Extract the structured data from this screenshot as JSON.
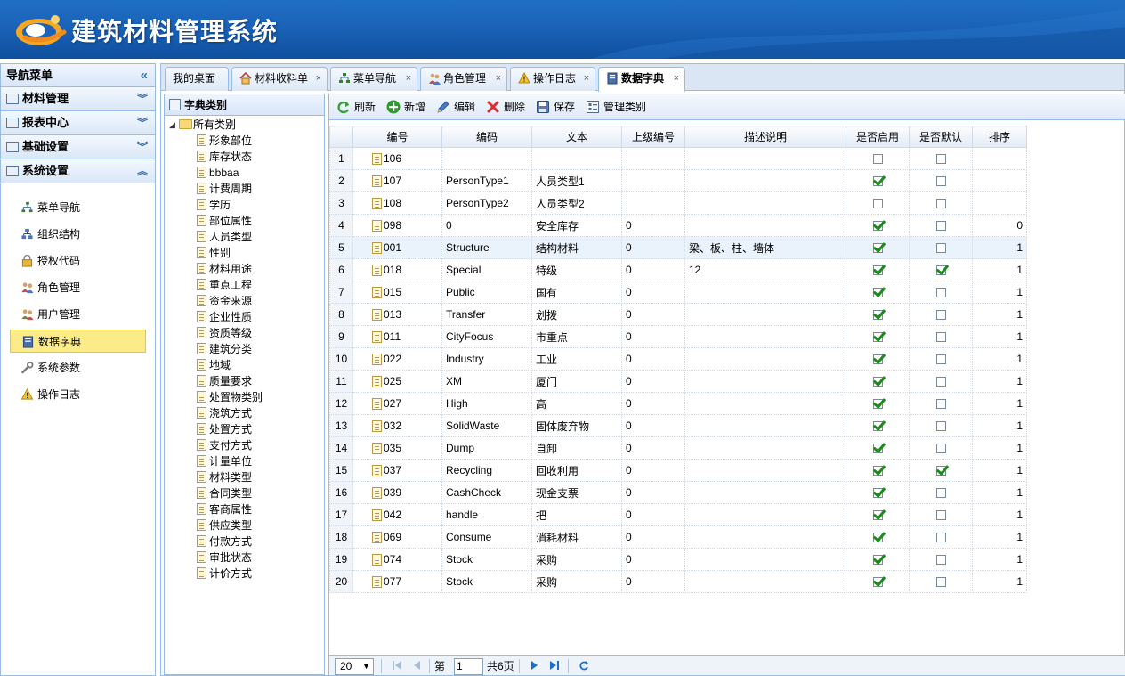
{
  "app": {
    "title": "建筑材料管理系统"
  },
  "nav": {
    "title": "导航菜单",
    "groups": [
      "材料管理",
      "报表中心",
      "基础设置",
      "系统设置"
    ],
    "items": [
      "菜单导航",
      "组织结构",
      "授权代码",
      "角色管理",
      "用户管理",
      "数据字典",
      "系统参数",
      "操作日志"
    ],
    "active_item": "数据字典"
  },
  "tabs": [
    {
      "label": "我的桌面"
    },
    {
      "label": "材料收料单"
    },
    {
      "label": "菜单导航"
    },
    {
      "label": "角色管理"
    },
    {
      "label": "操作日志"
    },
    {
      "label": "数据字典"
    }
  ],
  "active_tab": "数据字典",
  "tree": {
    "title": "字典类别",
    "root": "所有类别",
    "nodes": [
      "形象部位",
      "库存状态",
      "bbbaa",
      "计费周期",
      "学历",
      "部位属性",
      "人员类型",
      "性别",
      "材料用途",
      "重点工程",
      "资金来源",
      "企业性质",
      "资质等级",
      "建筑分类",
      "地域",
      "质量要求",
      "处置物类别",
      "浇筑方式",
      "处置方式",
      "支付方式",
      "计量单位",
      "材料类型",
      "合同类型",
      "客商属性",
      "供应类型",
      "付款方式",
      "审批状态",
      "计价方式"
    ]
  },
  "toolbar": {
    "refresh": "刷新",
    "add": "新增",
    "edit": "编辑",
    "delete": "删除",
    "save": "保存",
    "manage": "管理类别"
  },
  "grid": {
    "columns": [
      "编号",
      "编码",
      "文本",
      "上级编号",
      "描述说明",
      "是否启用",
      "是否默认",
      "排序"
    ],
    "rows": [
      {
        "n": "1",
        "id": "106",
        "code": "",
        "text": "",
        "parent": "",
        "desc": "",
        "enabled": false,
        "default": false,
        "order": ""
      },
      {
        "n": "2",
        "id": "107",
        "code": "PersonType1",
        "text": "人员类型1",
        "parent": "",
        "desc": "",
        "enabled": true,
        "default": false,
        "order": ""
      },
      {
        "n": "3",
        "id": "108",
        "code": "PersonType2",
        "text": "人员类型2",
        "parent": "",
        "desc": "",
        "enabled": false,
        "default": false,
        "order": ""
      },
      {
        "n": "4",
        "id": "098",
        "code": "0",
        "text": "安全库存",
        "parent": "0",
        "desc": "",
        "enabled": true,
        "default": false,
        "order": "0"
      },
      {
        "n": "5",
        "id": "001",
        "code": "Structure",
        "text": "结构材料",
        "parent": "0",
        "desc": "梁、板、柱、墙体",
        "enabled": true,
        "default": false,
        "order": "1"
      },
      {
        "n": "6",
        "id": "018",
        "code": "Special",
        "text": "特级",
        "parent": "0",
        "desc": "12",
        "enabled": true,
        "default": true,
        "order": "1"
      },
      {
        "n": "7",
        "id": "015",
        "code": "Public",
        "text": "国有",
        "parent": "0",
        "desc": "",
        "enabled": true,
        "default": false,
        "order": "1"
      },
      {
        "n": "8",
        "id": "013",
        "code": "Transfer",
        "text": "划拨",
        "parent": "0",
        "desc": "",
        "enabled": true,
        "default": false,
        "order": "1"
      },
      {
        "n": "9",
        "id": "011",
        "code": "CityFocus",
        "text": "市重点",
        "parent": "0",
        "desc": "",
        "enabled": true,
        "default": false,
        "order": "1"
      },
      {
        "n": "10",
        "id": "022",
        "code": "Industry",
        "text": "工业",
        "parent": "0",
        "desc": "",
        "enabled": true,
        "default": false,
        "order": "1"
      },
      {
        "n": "11",
        "id": "025",
        "code": "XM",
        "text": "厦门",
        "parent": "0",
        "desc": "",
        "enabled": true,
        "default": false,
        "order": "1"
      },
      {
        "n": "12",
        "id": "027",
        "code": "High",
        "text": "高",
        "parent": "0",
        "desc": "",
        "enabled": true,
        "default": false,
        "order": "1"
      },
      {
        "n": "13",
        "id": "032",
        "code": "SolidWaste",
        "text": "固体废弃物",
        "parent": "0",
        "desc": "",
        "enabled": true,
        "default": false,
        "order": "1"
      },
      {
        "n": "14",
        "id": "035",
        "code": "Dump",
        "text": "自卸",
        "parent": "0",
        "desc": "",
        "enabled": true,
        "default": false,
        "order": "1"
      },
      {
        "n": "15",
        "id": "037",
        "code": "Recycling",
        "text": "回收利用",
        "parent": "0",
        "desc": "",
        "enabled": true,
        "default": true,
        "order": "1"
      },
      {
        "n": "16",
        "id": "039",
        "code": "CashCheck",
        "text": "现金支票",
        "parent": "0",
        "desc": "",
        "enabled": true,
        "default": false,
        "order": "1"
      },
      {
        "n": "17",
        "id": "042",
        "code": "handle",
        "text": "把",
        "parent": "0",
        "desc": "",
        "enabled": true,
        "default": false,
        "order": "1"
      },
      {
        "n": "18",
        "id": "069",
        "code": "Consume",
        "text": "消耗材料",
        "parent": "0",
        "desc": "",
        "enabled": true,
        "default": false,
        "order": "1"
      },
      {
        "n": "19",
        "id": "074",
        "code": "Stock",
        "text": "采购",
        "parent": "0",
        "desc": "",
        "enabled": true,
        "default": false,
        "order": "1"
      },
      {
        "n": "20",
        "id": "077",
        "code": "Stock",
        "text": "采购",
        "parent": "0",
        "desc": "",
        "enabled": true,
        "default": false,
        "order": "1"
      }
    ],
    "selected_row": "5"
  },
  "pager": {
    "page_size": "20",
    "page_prefix": "第",
    "page_value": "1",
    "total_label": "共6页"
  },
  "colors": {
    "header": "#1a63b8",
    "active_nav": "#fbec88",
    "border": "#99bbe8"
  }
}
